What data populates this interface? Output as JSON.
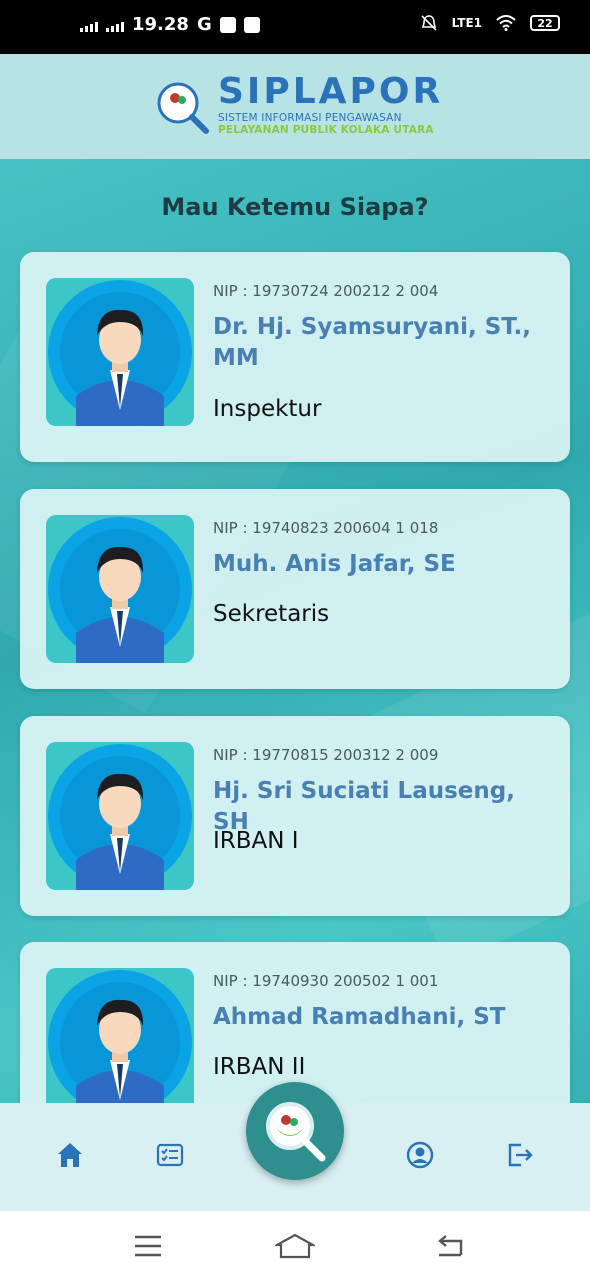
{
  "status_bar": {
    "time": "19.28",
    "battery": "22",
    "network": "LTE1"
  },
  "header": {
    "brand_title": "SIPLAPOR",
    "brand_subtitle_1": "SISTEM INFORMASI PENGAWASAN",
    "brand_subtitle_2": "PELAYANAN PUBLIK KOLAKA UTARA"
  },
  "page": {
    "title": "Mau Ketemu Siapa?"
  },
  "officials": [
    {
      "nip": "NIP : 19730724 200212 2 004",
      "name": "Dr. Hj. Syamsuryani, ST., MM",
      "role": "Inspektur"
    },
    {
      "nip": "NIP : 19740823 200604 1 018",
      "name": "Muh. Anis Jafar, SE",
      "role": "Sekretaris"
    },
    {
      "nip": "NIP : 19770815 200312 2 009",
      "name": "Hj. Sri Suciati Lauseng, SH",
      "role": "IRBAN I"
    },
    {
      "nip": "NIP : 19740930 200502 1 001",
      "name": "Ahmad Ramadhani, ST",
      "role": "IRBAN II"
    }
  ],
  "bottom_nav": {
    "items": [
      {
        "icon": "home-icon"
      },
      {
        "icon": "checklist-icon"
      },
      {
        "icon": "search-logo-icon"
      },
      {
        "icon": "user-icon"
      },
      {
        "icon": "logout-icon"
      }
    ]
  },
  "colors": {
    "accent": "#4a7fb1",
    "brand_green": "#8cc83f",
    "header_bg": "#b8e3e5",
    "fab": "#2e8f8e"
  }
}
